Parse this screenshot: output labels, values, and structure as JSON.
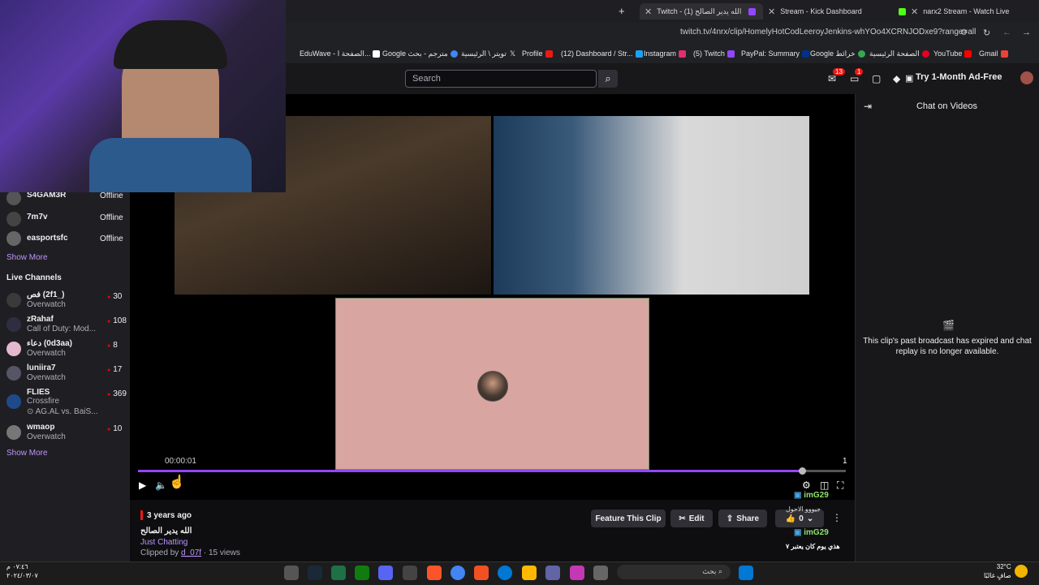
{
  "browser": {
    "tabs": [
      {
        "label": "Twitch - الله يدير الصالح (1)"
      },
      {
        "label": "Stream - Kick Dashboard"
      },
      {
        "label": "narx2 Stream - Watch Live"
      }
    ],
    "url": "twitch.tv/4nrx/clip/HomelyHotCodLeeroyJenkins-whYOo4XCRNJODxe9?range=all",
    "bookmarks": [
      {
        "label": "EduWave - الصفحة ا..."
      },
      {
        "label": "Google مترجم - بحث"
      },
      {
        "label": "تويتر \\ الرئيسية"
      },
      {
        "label": "Profile"
      },
      {
        "label": "(12) Dashboard / Str..."
      },
      {
        "label": "Instagram"
      },
      {
        "label": "(5) Twitch"
      },
      {
        "label": "PayPal: Summary"
      },
      {
        "label": "Google خرائط"
      },
      {
        "label": "الصفحة الرئيسية"
      },
      {
        "label": "YouTube"
      },
      {
        "label": "Gmail"
      }
    ]
  },
  "header": {
    "search_placeholder": "Search",
    "notif_count_1": "13",
    "notif_count_2": "1",
    "adfree_label": "Try 1-Month Ad-Free"
  },
  "sidebar": {
    "followed": [
      {
        "name": "S4GAM3R",
        "status": "Offline"
      },
      {
        "name": "7m7v",
        "status": "Offline"
      },
      {
        "name": "easportsfc",
        "status": "Offline"
      }
    ],
    "show_more_1": "Show More",
    "live_heading": "Live Channels",
    "live": [
      {
        "name": "فص (2f1_)",
        "game": "Overwatch",
        "viewers": "30"
      },
      {
        "name": "zRahaf",
        "game": "Call of Duty: Mod...",
        "viewers": "108"
      },
      {
        "name": "دعاء (0d3aa)",
        "game": "Overwatch",
        "viewers": "8"
      },
      {
        "name": "luniira7",
        "game": "Overwatch",
        "viewers": "17"
      },
      {
        "name": "FLIES",
        "game": "Crossfire",
        "extra": "AG.AL vs. BaiS...",
        "viewers": "369"
      },
      {
        "name": "wmaop",
        "game": "Overwatch",
        "viewers": "10"
      }
    ],
    "show_more_2": "Show More"
  },
  "player": {
    "timecode": "00:00:01",
    "counter": "1",
    "progress_fraction": 0.995
  },
  "chat": {
    "title": "Chat on Videos",
    "message": "This clip's past broadcast has expired and chat replay is no longer available."
  },
  "clip": {
    "ago": "3 years ago",
    "title": "الله يدير الصالح",
    "category": "Just Chatting",
    "clipped_by_prefix": "Clipped by",
    "clipper": "d_07f",
    "views": "· 15 views",
    "feature_label": "Feature This Clip",
    "edit_label": "Edit",
    "share_label": "Share",
    "likes": "0"
  },
  "overlay_chat": [
    {
      "user": "imG29",
      "text": "جيووو الاحول"
    },
    {
      "user": "imG29",
      "text": "هذي يوم كان يعتبر ٧"
    }
  ],
  "taskbar": {
    "search": "بحث",
    "time": "٠٧:٤٦ م",
    "date": "٢٠٢٤/٠٣/٠٧",
    "temp": "32°C",
    "weather": "صافٍ غالبًا"
  }
}
